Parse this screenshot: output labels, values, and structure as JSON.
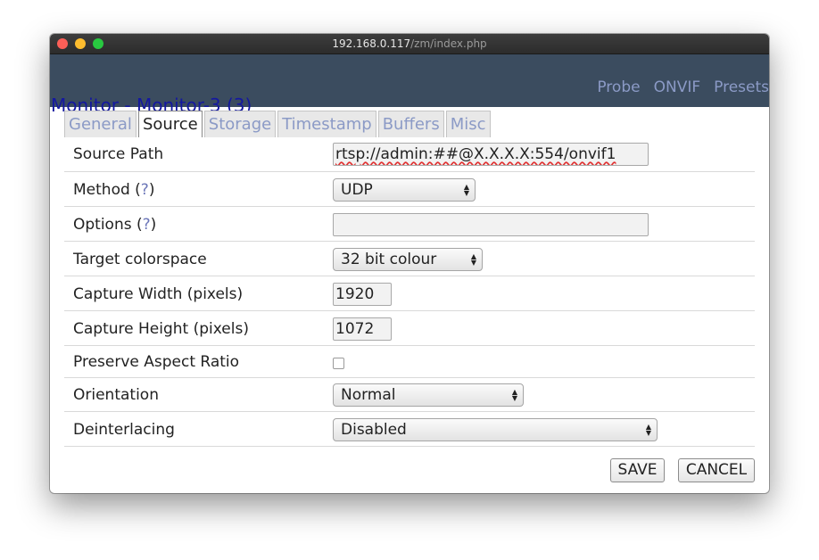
{
  "browser": {
    "host": "192.168.0.117",
    "path": "/zm/index.php"
  },
  "header": {
    "title": "Monitor - Monitor-3 (3)",
    "links": [
      "Probe",
      "ONVIF",
      "Presets"
    ]
  },
  "tabs": {
    "items": [
      "General",
      "Source",
      "Storage",
      "Timestamp",
      "Buffers",
      "Misc"
    ],
    "active": "Source"
  },
  "form": {
    "source_path": {
      "label": "Source Path",
      "value": "rtsp://admin:##@X.X.X.X:554/onvif1"
    },
    "method": {
      "label": "Method (",
      "help": "?",
      "close": ")",
      "value": "UDP"
    },
    "options": {
      "label": "Options (",
      "help": "?",
      "close": ")",
      "value": ""
    },
    "colorspace": {
      "label": "Target colorspace",
      "value": "32 bit colour"
    },
    "capture_width": {
      "label": "Capture Width (pixels)",
      "value": "1920"
    },
    "capture_height": {
      "label": "Capture Height (pixels)",
      "value": "1072"
    },
    "aspect_ratio": {
      "label": "Preserve Aspect Ratio",
      "checked": false
    },
    "orientation": {
      "label": "Orientation",
      "value": "Normal"
    },
    "deinterlacing": {
      "label": "Deinterlacing",
      "value": "Disabled"
    }
  },
  "buttons": {
    "save": "SAVE",
    "cancel": "CANCEL"
  },
  "colors": {
    "header_bg": "#3b4c5f",
    "title": "#1418a0",
    "link": "#8b9ac6"
  }
}
